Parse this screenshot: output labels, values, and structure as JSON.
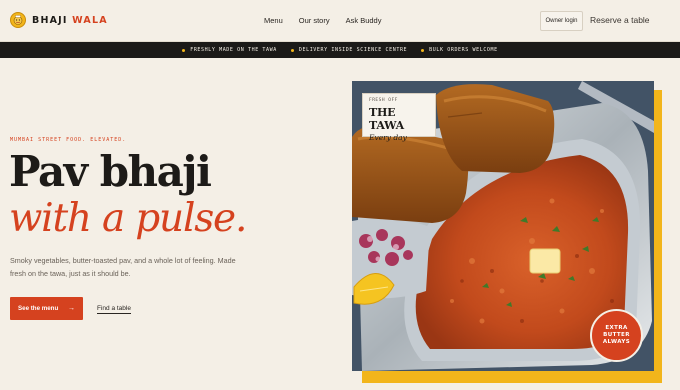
{
  "brand": {
    "word1": "BHAJI",
    "word2": "WALA"
  },
  "nav": {
    "items": [
      "Menu",
      "Our story",
      "Ask Buddy"
    ]
  },
  "header": {
    "owner_login": "Owner login",
    "reserve": "Reserve a table"
  },
  "ticker": {
    "items": [
      "FRESHLY MADE ON THE TAWA",
      "DELIVERY INSIDE SCIENCE CENTRE",
      "BULK ORDERS WELCOME"
    ]
  },
  "hero": {
    "eyebrow": "MUMBAI STREET FOOD. ELEVATED.",
    "title_line1": "Pav bhaji",
    "title_line2": "with a pulse.",
    "lede": "Smoky vegetables, butter-toasted pav, and a whole lot of feeling. Made fresh on the tawa, just as it should be.",
    "cta_primary": "See the menu",
    "cta_arrow": "→",
    "cta_secondary": "Find a table"
  },
  "photo_card": {
    "kicker": "FRESH OFF",
    "title": "THE TAWA",
    "subtitle": "Every day"
  },
  "stamp": {
    "text": "EXTRA BUTTER ALWAYS"
  },
  "colors": {
    "accent": "#d5421f",
    "yellow": "#f2b51b",
    "background": "#f4efe6",
    "ticker_bg": "#1b1a18"
  }
}
